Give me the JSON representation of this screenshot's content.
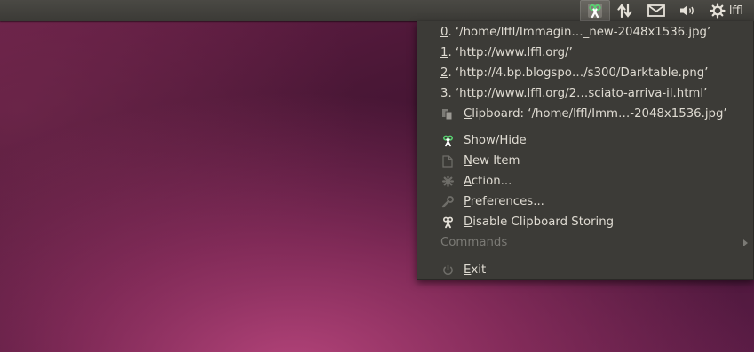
{
  "panel": {
    "user": "lffl",
    "tray_icons": [
      "clipboard-scissors-icon",
      "network-updown-icon",
      "mail-envelope-icon",
      "volume-speaker-icon",
      "settings-gear-icon"
    ]
  },
  "menu": {
    "history": [
      {
        "key": "0",
        "text": ". ‘/home/lffl/Immagin…_new-2048x1536.jpg’"
      },
      {
        "key": "1",
        "text": ". ‘http://www.lffl.org/’"
      },
      {
        "key": "2",
        "text": ". ‘http://4.bp.blogspo…/s300/Darktable.png’"
      },
      {
        "key": "3",
        "text": ". ‘http://www.lffl.org/2…sciato-arriva-il.html’"
      }
    ],
    "clipboard": {
      "key": "C",
      "rest": "lipboard: ‘/home/lffl/Imm…-2048x1536.jpg’"
    },
    "show_hide": {
      "key": "S",
      "rest": "how/Hide"
    },
    "new_item": {
      "key": "N",
      "rest": "ew Item"
    },
    "action": {
      "key": "A",
      "rest": "ction..."
    },
    "preferences": {
      "key": "P",
      "rest": "references..."
    },
    "disable": {
      "key": "D",
      "rest": "isable Clipboard Storing"
    },
    "commands": "Commands",
    "exit": {
      "key": "E",
      "rest": "xit"
    }
  }
}
